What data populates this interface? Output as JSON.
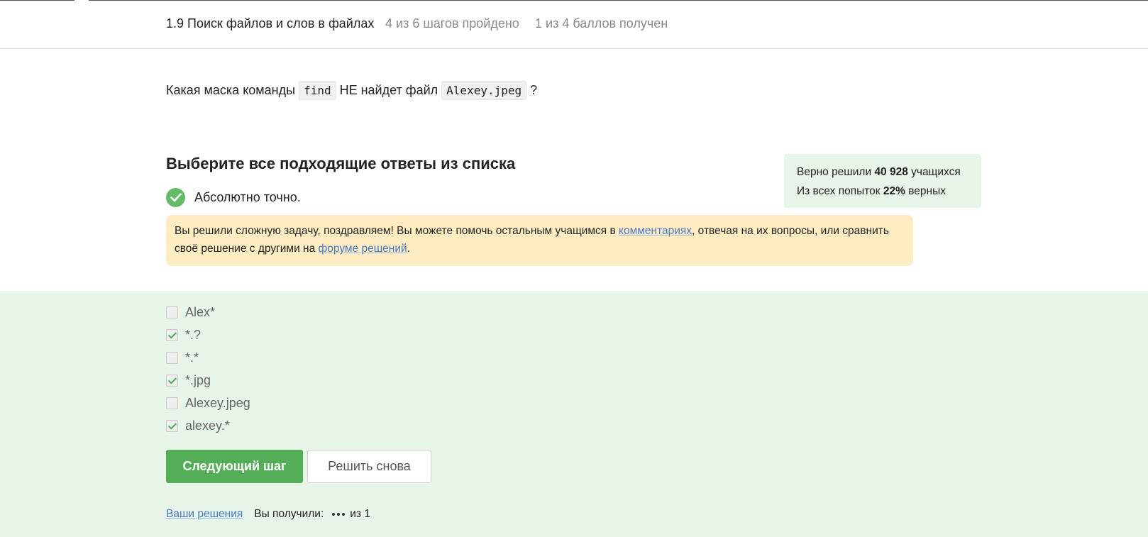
{
  "header": {
    "lesson_title": "1.9 Поиск файлов и слов в файлах",
    "steps_progress": "4 из 6 шагов пройдено",
    "points_progress": "1 из 4 баллов  получен"
  },
  "question": {
    "prefix": "Какая маска команды",
    "command": "find",
    "middle": "НЕ найдет файл",
    "filename": "Alexey.jpeg",
    "suffix": "?"
  },
  "quiz": {
    "instruction": "Выберите все подходящие ответы из списка",
    "feedback": "Абсолютно точно.",
    "check_icon": "check-circle-icon",
    "congrats": {
      "part1": "Вы решили сложную задачу, поздравляем! Вы можете помочь остальным учащимся в",
      "link1": "комментариях",
      "part2": ", отвечая на их вопросы, или сравнить своё решение с другими на",
      "link2": "форуме решений",
      "part3": "."
    },
    "options": [
      {
        "label": "Alex*",
        "checked": false
      },
      {
        "label": "*.?",
        "checked": true
      },
      {
        "label": "*.*",
        "checked": false
      },
      {
        "label": "*.jpg",
        "checked": true
      },
      {
        "label": "Alexey.jpeg",
        "checked": false
      },
      {
        "label": "alexey.*",
        "checked": true
      }
    ]
  },
  "stats": {
    "line1_prefix": "Верно решили",
    "solved_count": "40 928",
    "line1_suffix": "учащихся",
    "line2_prefix": "Из всех попыток",
    "percent": "22%",
    "line2_suffix": "верных"
  },
  "buttons": {
    "next": "Следующий шаг",
    "retry": "Решить снова"
  },
  "footer": {
    "your_solutions": "Ваши решения",
    "received_label": "Вы получили:",
    "out_of": "из 1"
  },
  "colors": {
    "accent_green": "#54ae57",
    "answers_bg": "#e8f6e9",
    "congrats_bg": "#feedc3",
    "link": "#4a78c4"
  }
}
